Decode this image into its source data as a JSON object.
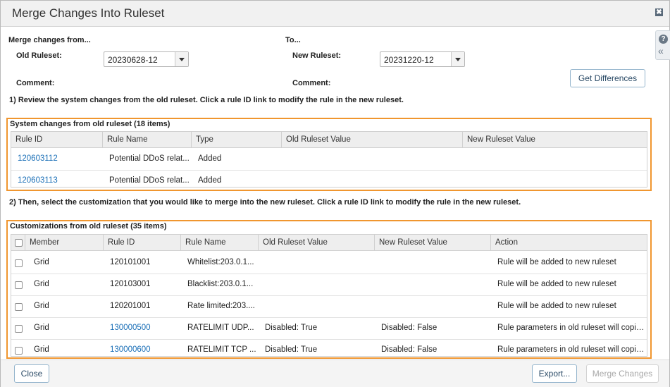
{
  "dialog": {
    "title": "Merge Changes Into Ruleset",
    "close_glyph": "✖"
  },
  "side": {
    "help_glyph": "?",
    "collapse_glyph": "«"
  },
  "form": {
    "merge_from_label": "Merge changes from...",
    "to_label": "To...",
    "old_ruleset_label": "Old Ruleset:",
    "old_ruleset_value": "20230628-12",
    "new_ruleset_label": "New Ruleset:",
    "new_ruleset_value": "20231220-12",
    "comment_label_left": "Comment:",
    "comment_label_right": "Comment:",
    "get_differences_label": "Get Differences"
  },
  "step1": "1) Review the system changes from the old ruleset. Click a rule ID link to modify the rule in the new ruleset.",
  "step2": "2) Then, select the customization that you would like to merge into the new ruleset. Click a rule ID link to modify the rule in the new ruleset.",
  "system_changes": {
    "title": "System changes from old ruleset (18 items)",
    "columns": [
      "Rule ID",
      "Rule Name",
      "Type",
      "Old Ruleset Value",
      "New Ruleset Value"
    ],
    "rows": [
      {
        "rule_id": "120603112",
        "rule_name": "Potential DDoS relat...",
        "type": "Added",
        "old": "",
        "new": ""
      },
      {
        "rule_id": "120603113",
        "rule_name": "Potential DDoS relat...",
        "type": "Added",
        "old": "",
        "new": ""
      }
    ]
  },
  "customizations": {
    "title": "Customizations from old ruleset (35 items)",
    "columns": [
      "Member",
      "Rule ID",
      "Rule Name",
      "Old Ruleset Value",
      "New Ruleset Value",
      "Action"
    ],
    "rows": [
      {
        "member": "Grid",
        "rule_id": "120101001",
        "rule_id_link": false,
        "rule_name": "Whitelist:203.0.1...",
        "old": "",
        "new": "",
        "action": "Rule will be added to new ruleset"
      },
      {
        "member": "Grid",
        "rule_id": "120103001",
        "rule_id_link": false,
        "rule_name": "Blacklist:203.0.1...",
        "old": "",
        "new": "",
        "action": "Rule will be added to new ruleset"
      },
      {
        "member": "Grid",
        "rule_id": "120201001",
        "rule_id_link": false,
        "rule_name": "Rate limited:203....",
        "old": "",
        "new": "",
        "action": "Rule will be added to new ruleset"
      },
      {
        "member": "Grid",
        "rule_id": "130000500",
        "rule_id_link": true,
        "rule_name": "RATELIMIT UDP...",
        "old": "Disabled: True",
        "new": "Disabled: False",
        "action": "Rule parameters in old ruleset will copie..."
      },
      {
        "member": "Grid",
        "rule_id": "130000600",
        "rule_id_link": true,
        "rule_name": "RATELIMIT TCP ...",
        "old": "Disabled: True",
        "new": "Disabled: False",
        "action": "Rule parameters in old ruleset will copie..."
      }
    ]
  },
  "footer": {
    "close_label": "Close",
    "export_label": "Export...",
    "merge_label": "Merge Changes"
  }
}
